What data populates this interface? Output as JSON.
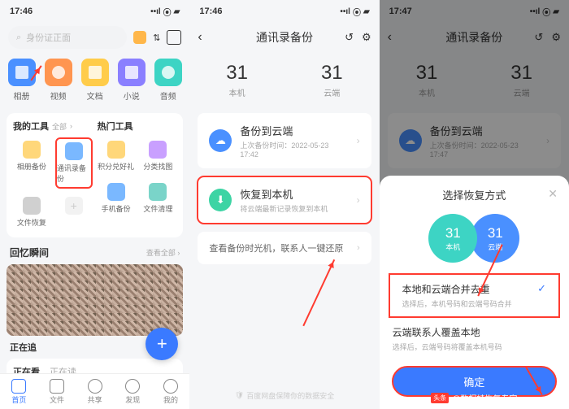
{
  "p1": {
    "time": "17:46",
    "search_placeholder": "身份证正面",
    "cats": [
      {
        "label": "相册"
      },
      {
        "label": "视频"
      },
      {
        "label": "文档"
      },
      {
        "label": "小说"
      },
      {
        "label": "音频"
      }
    ],
    "my_tools_title": "我的工具",
    "all": "全部",
    "hot_tools_title": "热门工具",
    "my_tools": [
      {
        "label": "相册备份"
      },
      {
        "label": "通讯录备份"
      },
      {
        "label": "文件恢复"
      },
      {
        "label": ""
      }
    ],
    "hot_tools": [
      {
        "label": "积分兑好礼"
      },
      {
        "label": "分类找图"
      },
      {
        "label": "手机备份"
      },
      {
        "label": "文件清理"
      }
    ],
    "memories_title": "回忆瞬间",
    "view_all": "查看全部",
    "tracking_title": "正在追",
    "track_tabs": [
      "正在看",
      "正在读"
    ],
    "tabs": [
      {
        "label": "首页"
      },
      {
        "label": "文件"
      },
      {
        "label": "共享"
      },
      {
        "label": "发现"
      },
      {
        "label": "我的"
      }
    ]
  },
  "p2": {
    "time": "17:46",
    "nav_title": "通讯录备份",
    "local": {
      "num": "31",
      "lbl": "本机"
    },
    "cloud": {
      "num": "31",
      "lbl": "云端"
    },
    "backup": {
      "title": "备份到云端",
      "sub": "上次备份时间：2022-05-23 17:42"
    },
    "restore": {
      "title": "恢复到本机",
      "sub": "将云端最新记录恢复到本机"
    },
    "history": "查看备份时光机，联系人一键还原",
    "footer": "百度网盘保障你的数据安全"
  },
  "p3": {
    "time": "17:47",
    "nav_title": "通讯录备份",
    "local": {
      "num": "31",
      "lbl": "本机"
    },
    "cloud": {
      "num": "31",
      "lbl": "云端"
    },
    "backup": {
      "title": "备份到云端",
      "sub": "上次备份时间：2022-05-23 17:47"
    },
    "sheet_title": "选择恢复方式",
    "circ_local": {
      "n": "31",
      "l": "本机"
    },
    "circ_cloud": {
      "n": "31",
      "l": "云端"
    },
    "m1": {
      "t": "本地和云端合并去重",
      "s": "选择后，本机号码和云端号码合并"
    },
    "m2": {
      "t": "云端联系人覆盖本地",
      "s": "选择后，云端号码将覆盖本机号码"
    },
    "confirm": "确定",
    "attribution_prefix": "头条",
    "attribution": "@数据蛙恢复专家"
  }
}
